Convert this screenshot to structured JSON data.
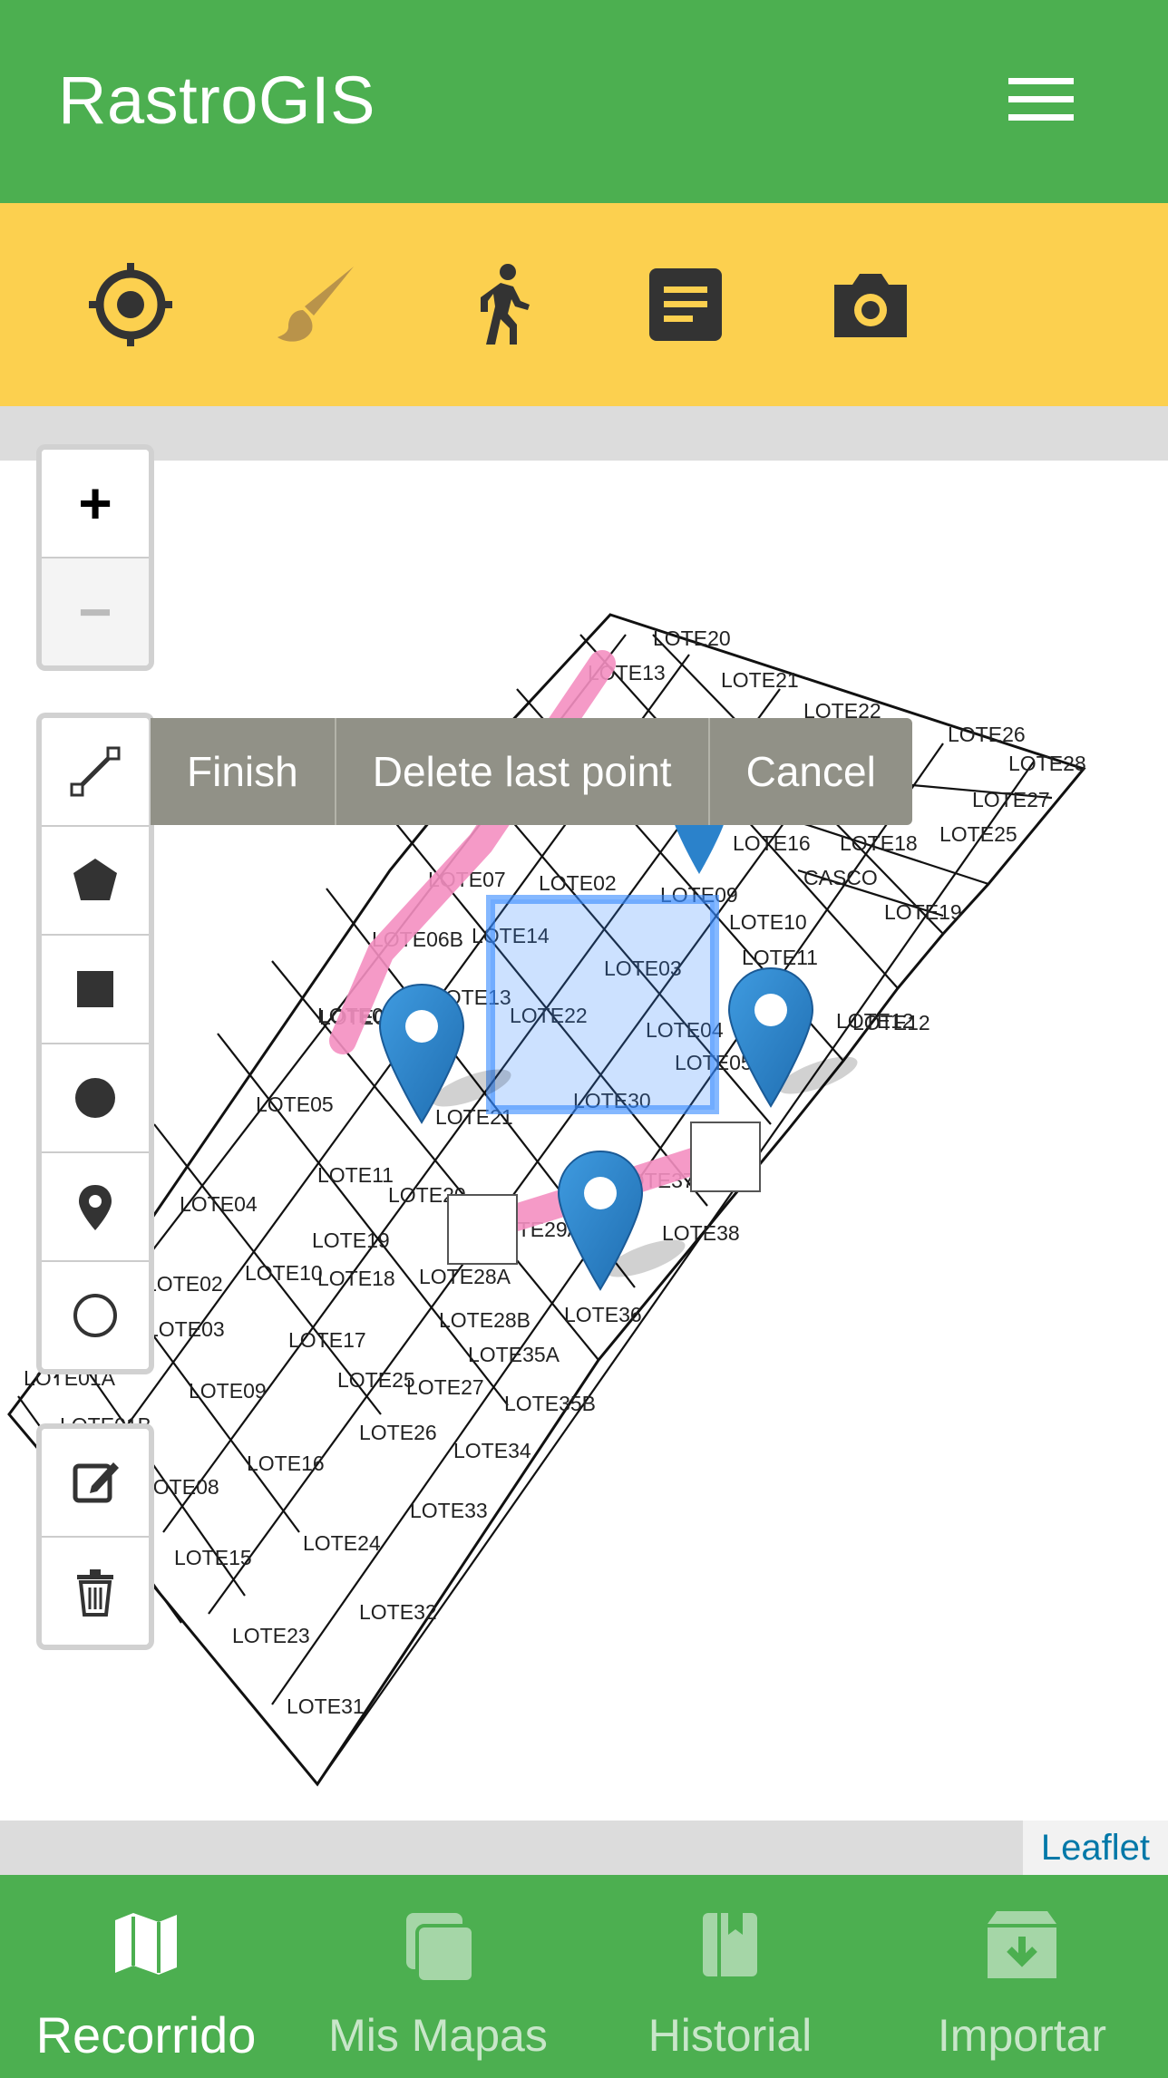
{
  "app": {
    "title": "RastroGIS",
    "menu_icon": "hamburger-menu-icon"
  },
  "toolbar": {
    "tools": [
      {
        "name": "gps-location-icon",
        "active": false
      },
      {
        "name": "brush-icon",
        "active": true
      },
      {
        "name": "walking-person-icon",
        "active": false
      },
      {
        "name": "notes-icon",
        "active": false
      },
      {
        "name": "camera-icon",
        "active": false
      }
    ]
  },
  "map": {
    "zoom_in_label": "+",
    "zoom_out_label": "−",
    "draw_actions": {
      "finish": "Finish",
      "delete_last": "Delete last point",
      "cancel": "Cancel"
    },
    "draw_tools": [
      "polyline-icon",
      "polygon-icon",
      "rectangle-icon",
      "circle-icon",
      "marker-icon",
      "circle-marker-icon"
    ],
    "edit_tools": [
      "edit-icon",
      "trash-icon"
    ],
    "attribution": "Leaflet",
    "lot_labels": [
      "LOTE20",
      "LOTE13",
      "LOTE21",
      "LOTE22",
      "LOTE26",
      "LOTE28",
      "LOTE27",
      "LOTE25",
      "LOTE16",
      "LOTE18",
      "LOTE07",
      "LOTE02",
      "LOTE09",
      "CASCO",
      "LOTE19",
      "LOTE10",
      "LOTE06B",
      "LOTE14",
      "LOTE03",
      "LOTE11",
      "LOTE13",
      "LOTE22",
      "LOTE04",
      "LOTE12",
      "LOTE05",
      "LOTE30",
      "LOTE06",
      "LOTE05",
      "LOTE21",
      "LOTE11",
      "LOTE20",
      "LOTE37",
      "LOTE04",
      "LOTE29A",
      "LOTE38",
      "LOTE19",
      "LOTE10",
      "LOTE18",
      "LOTE28A",
      "LOTE36",
      "LOTE02",
      "LOTE03",
      "LOTE17",
      "LOTE28B",
      "LOTE35A",
      "LOTE01A",
      "LOTE09",
      "LOTE25",
      "LOTE27",
      "LOTE35B",
      "LOTE01B",
      "LOTE26",
      "LOTE34",
      "LOTE08",
      "LOTE16",
      "LOTE33",
      "LOTE15",
      "LOTE24",
      "LOTE32",
      "LOTE23",
      "LOTE31",
      "LOTE06",
      "LOTE12"
    ]
  },
  "bottom_nav": {
    "items": [
      {
        "label": "Recorrido",
        "icon": "map-icon",
        "active": true
      },
      {
        "label": "Mis Mapas",
        "icon": "layers-icon",
        "active": false
      },
      {
        "label": "Historial",
        "icon": "book-icon",
        "active": false
      },
      {
        "label": "Importar",
        "icon": "archive-download-icon",
        "active": false
      }
    ]
  },
  "colors": {
    "primary": "#4caf50",
    "toolbar": "#fcd04f",
    "draw_track": "#f48fc1",
    "selection": "#3388ff",
    "marker": "#2b82cb"
  }
}
